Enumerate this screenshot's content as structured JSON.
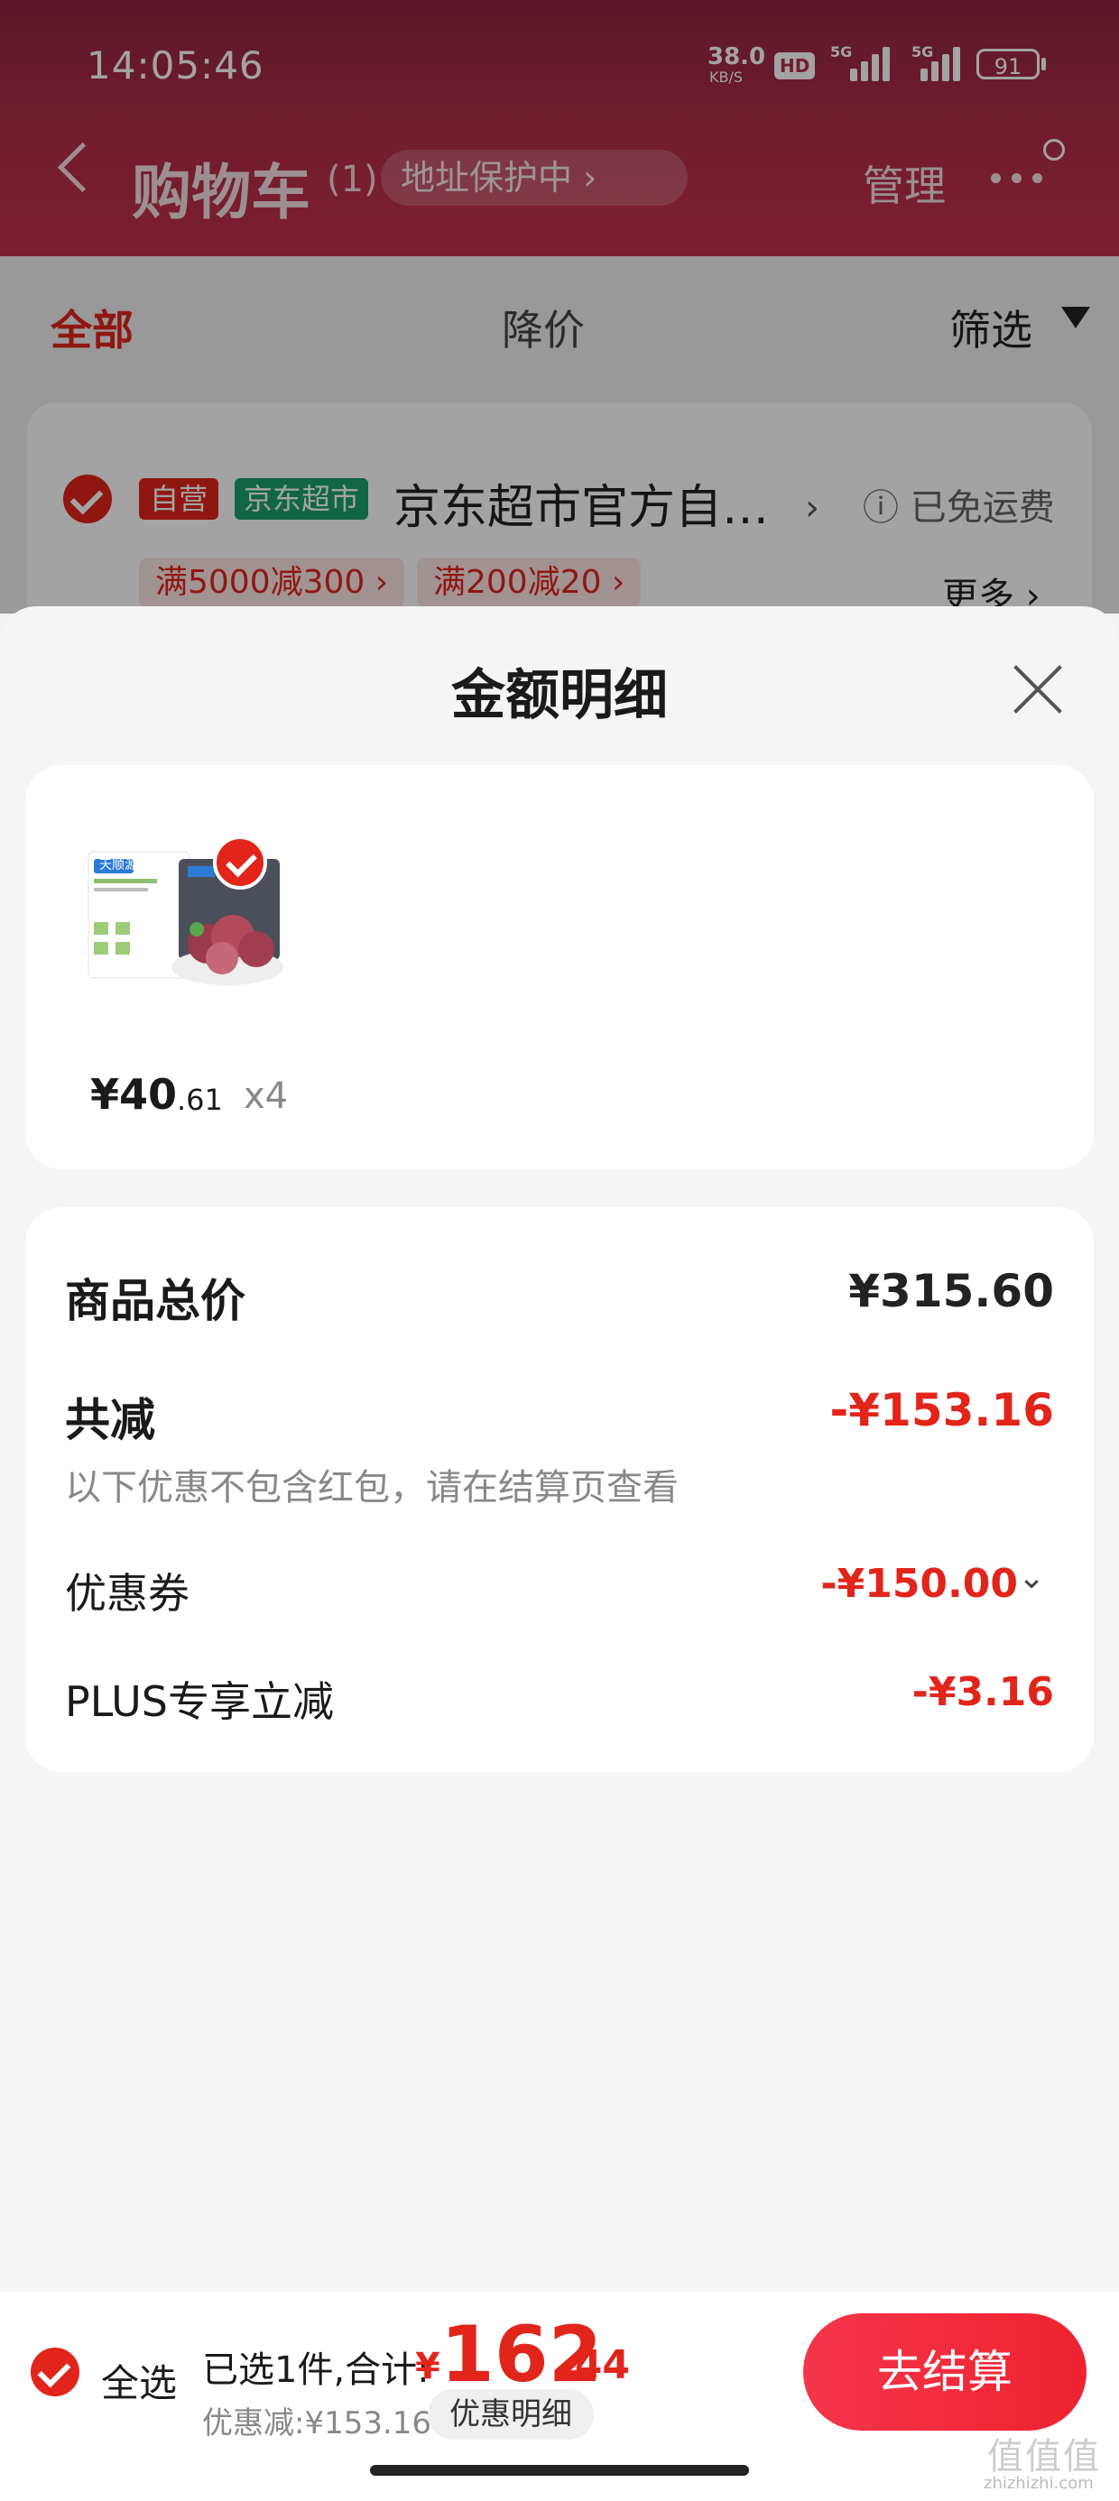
{
  "status_bar": {
    "time": "14:05:46",
    "net_speed": "38.0",
    "net_unit": "KB/S",
    "hd": "HD",
    "sig1": "5G",
    "sig2": "5G",
    "battery": "91"
  },
  "header": {
    "title": "购物车",
    "count": "(1)",
    "address_pill": "地址保护中 ›",
    "manage": "管理"
  },
  "tabs": {
    "all": "全部",
    "price_drop": "降价",
    "filter": "筛选"
  },
  "store": {
    "tag_self": "自营",
    "tag_jd": "京东超市",
    "name": "京东超市官方自…",
    "arrow": "›",
    "shipping": "ⓘ 已免运费",
    "promos": [
      "满5000减300 ›",
      "满200减20 ›"
    ],
    "more": "更多 ›"
  },
  "sheet": {
    "title": "金额明细",
    "product": {
      "brand": "天顺源",
      "price_main": "¥40",
      "price_cents": ".61",
      "qty": "x4"
    },
    "details": {
      "total_label": "商品总价",
      "total_value": "¥315.60",
      "reduce_label": "共减",
      "reduce_value": "-¥153.16",
      "hint": "以下优惠不包含红包，请在结算页查看",
      "coupon_label": "优惠券",
      "coupon_value": "-¥150.00",
      "coupon_chevron": "⌄",
      "plus_label": "PLUS专享立减",
      "plus_value": "-¥3.16"
    }
  },
  "bottom": {
    "select_all": "全选",
    "selected_text": "已选1件,合计:",
    "yen": "¥",
    "total_int": "162",
    "total_dec": ".44",
    "discount_text": "优惠减:¥153.16",
    "detail_button": "优惠明细",
    "checkout": "去结算"
  },
  "watermark": {
    "text": "值值值",
    "url": "zhizhizhi.com"
  },
  "colors": {
    "brand_red": "#e1251b",
    "header": "#b52d4b"
  }
}
